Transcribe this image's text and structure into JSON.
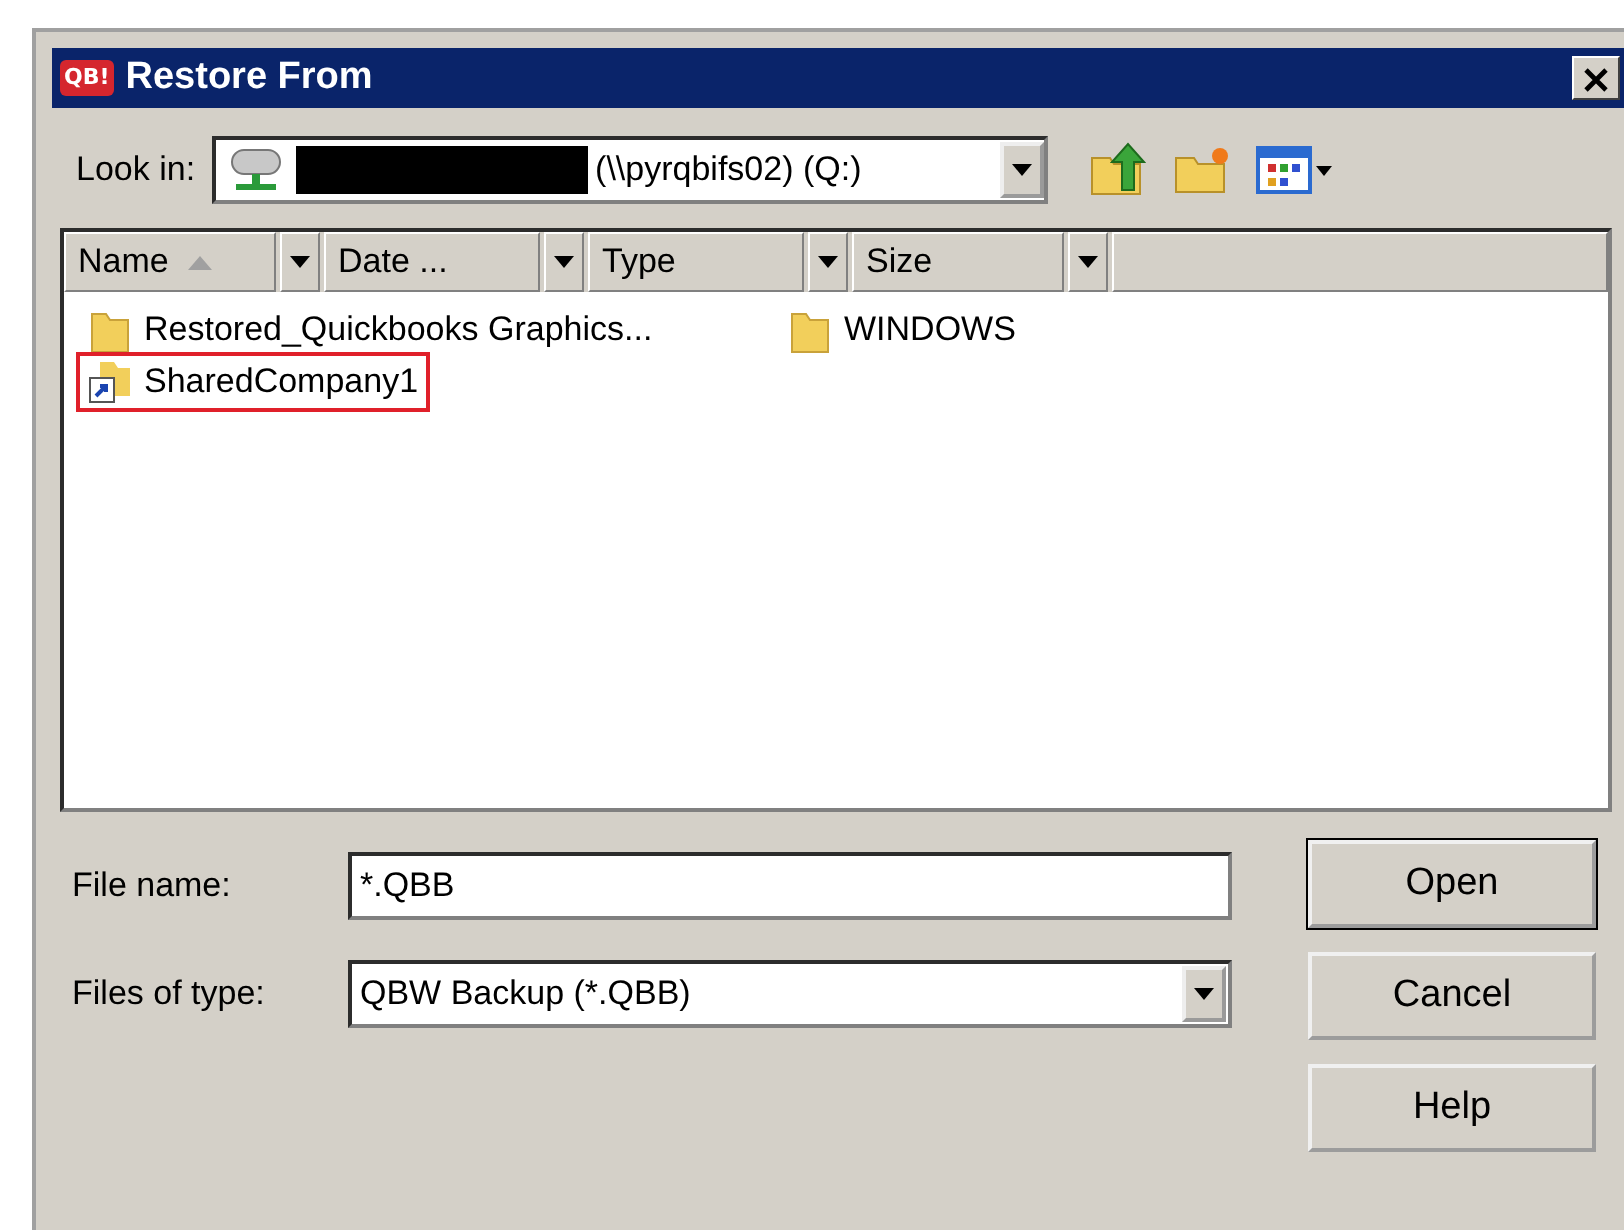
{
  "window": {
    "title": "Restore From",
    "logo": "QB!"
  },
  "look_in": {
    "label": "Look in:",
    "value": "(\\\\pyrqbifs02) (Q:)",
    "redacted": true
  },
  "columns": [
    {
      "label": "Name",
      "sorted": true
    },
    {
      "label": "Date ...",
      "sorted": false
    },
    {
      "label": "Type",
      "sorted": false
    },
    {
      "label": "Size",
      "sorted": false
    }
  ],
  "files": [
    {
      "name": "Restored_Quickbooks Graphics...",
      "kind": "folder",
      "highlighted": false
    },
    {
      "name": "SharedCompany1",
      "kind": "shortcut",
      "highlighted": true
    },
    {
      "name": "WINDOWS",
      "kind": "folder",
      "highlighted": false
    }
  ],
  "file_name": {
    "label": "File name:",
    "value": "*.QBB"
  },
  "files_of_type": {
    "label": "Files of type:",
    "value": "QBW Backup (*.QBB)"
  },
  "buttons": [
    {
      "label": "Open",
      "default": true
    },
    {
      "label": "Cancel",
      "default": false
    },
    {
      "label": "Help",
      "default": false
    }
  ]
}
